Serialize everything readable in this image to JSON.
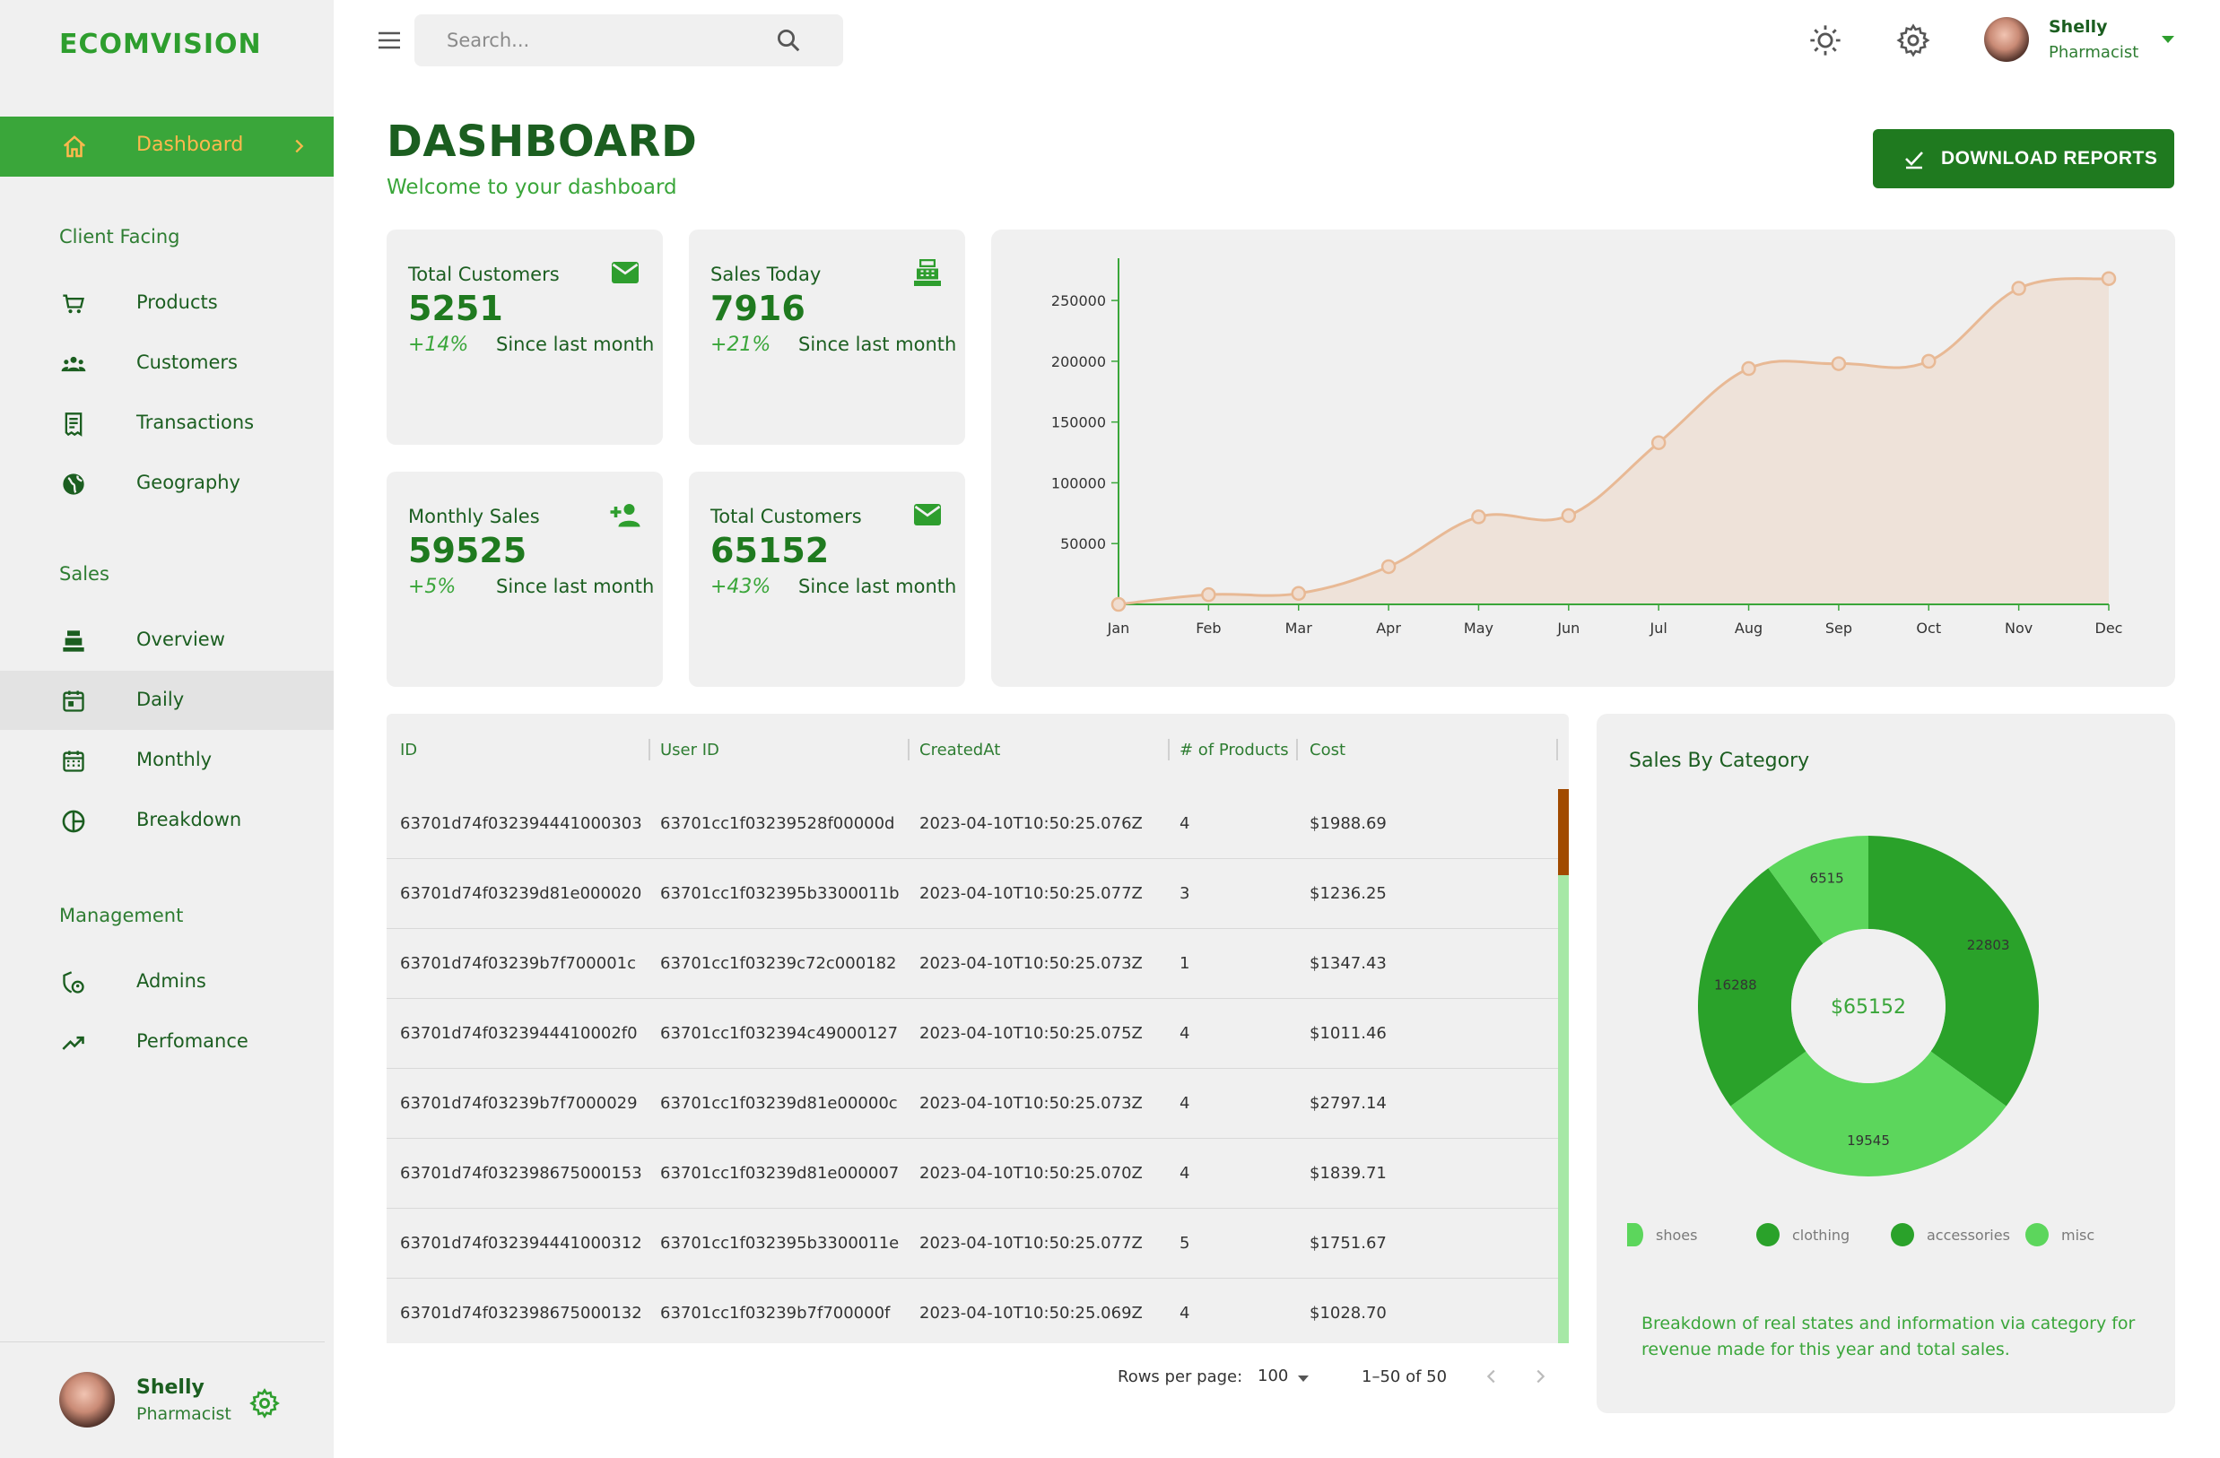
{
  "brand": "ECOMVISION",
  "sidebar": {
    "active": {
      "label": "Dashboard",
      "icon": "home-icon"
    },
    "sections": {
      "client_facing": "Client Facing",
      "sales": "Sales",
      "management": "Management"
    },
    "items": [
      {
        "label": "Products",
        "icon": "cart-icon"
      },
      {
        "label": "Customers",
        "icon": "people-icon"
      },
      {
        "label": "Transactions",
        "icon": "receipt-icon"
      },
      {
        "label": "Geography",
        "icon": "globe-icon"
      },
      {
        "label": "Overview",
        "icon": "cash-register-icon"
      },
      {
        "label": "Daily",
        "icon": "calendar-today-icon"
      },
      {
        "label": "Monthly",
        "icon": "calendar-month-icon"
      },
      {
        "label": "Breakdown",
        "icon": "pie-icon"
      },
      {
        "label": "Admins",
        "icon": "admin-icon"
      },
      {
        "label": "Perfomance",
        "icon": "trending-up-icon"
      }
    ],
    "user": {
      "name": "Shelly",
      "role": "Pharmacist"
    }
  },
  "topbar": {
    "search_placeholder": "Search...",
    "user": {
      "name": "Shelly",
      "role": "Pharmacist"
    }
  },
  "header": {
    "title": "DASHBOARD",
    "subtitle": "Welcome to your dashboard",
    "download_label": "DOWNLOAD REPORTS"
  },
  "stats": [
    {
      "title": "Total Customers",
      "value": "5251",
      "increase": "+14%",
      "note": "Since last month",
      "icon": "email-icon"
    },
    {
      "title": "Sales Today",
      "value": "7916",
      "increase": "+21%",
      "note": "Since last month",
      "icon": "point-of-sale-icon"
    },
    {
      "title": "Monthly Sales",
      "value": "59525",
      "increase": "+5%",
      "note": "Since last month",
      "icon": "person-add-icon"
    },
    {
      "title": "Total Customers",
      "value": "65152",
      "increase": "+43%",
      "note": "Since last month",
      "icon": "email-icon"
    }
  ],
  "chart_data": [
    {
      "type": "area",
      "x": [
        "Jan",
        "Feb",
        "Mar",
        "Apr",
        "May",
        "Jun",
        "Jul",
        "Aug",
        "Sep",
        "Oct",
        "Nov",
        "Dec"
      ],
      "series": [
        {
          "values": [
            0,
            8000,
            9000,
            31000,
            72000,
            73000,
            133000,
            194000,
            198000,
            200000,
            260000,
            268000
          ]
        }
      ],
      "y_ticks": [
        "50000",
        "100000",
        "150000",
        "200000",
        "250000"
      ],
      "ylim": [
        0,
        270000
      ],
      "grid": false,
      "color": "#e8b995"
    },
    {
      "type": "pie",
      "title": "Sales By Category",
      "center_label": "$65152",
      "categories": [
        "shoes",
        "clothing",
        "accessories",
        "misc"
      ],
      "values": [
        22803,
        19545,
        16288,
        6515
      ],
      "colors": [
        "#2aa22a",
        "#5cd65c",
        "#2aa22a",
        "#5cd65c"
      ],
      "legend_position": "bottom"
    }
  ],
  "table": {
    "columns": [
      "ID",
      "User ID",
      "CreatedAt",
      "# of Products",
      "Cost"
    ],
    "rows": [
      [
        "63701d74f032394441000303",
        "63701cc1f03239528f00000d",
        "2023-04-10T10:50:25.076Z",
        "4",
        "$1988.69"
      ],
      [
        "63701d74f03239d81e000020",
        "63701cc1f032395b3300011b",
        "2023-04-10T10:50:25.077Z",
        "3",
        "$1236.25"
      ],
      [
        "63701d74f03239b7f700001c",
        "63701cc1f03239c72c000182",
        "2023-04-10T10:50:25.073Z",
        "1",
        "$1347.43"
      ],
      [
        "63701d74f0323944410002f0",
        "63701cc1f032394c49000127",
        "2023-04-10T10:50:25.075Z",
        "4",
        "$1011.46"
      ],
      [
        "63701d74f03239b7f7000029",
        "63701cc1f03239d81e00000c",
        "2023-04-10T10:50:25.073Z",
        "4",
        "$2797.14"
      ],
      [
        "63701d74f032398675000153",
        "63701cc1f03239d81e000007",
        "2023-04-10T10:50:25.070Z",
        "4",
        "$1839.71"
      ],
      [
        "63701d74f032394441000312",
        "63701cc1f032395b3300011e",
        "2023-04-10T10:50:25.077Z",
        "5",
        "$1751.67"
      ],
      [
        "63701d74f032398675000132",
        "63701cc1f03239b7f700000f",
        "2023-04-10T10:50:25.069Z",
        "4",
        "$1028.70"
      ]
    ],
    "pagination": {
      "rows_per_page_label": "Rows per page:",
      "rows_per_page": "100",
      "range": "1–50 of 50"
    }
  },
  "pie_description": "Breakdown of real states and information via category for revenue made for this year and total sales.",
  "colors": {
    "brand": "#2e9e2e",
    "dark": "#1b5e20",
    "accent": "#ffb84d",
    "area": "#e8b995"
  }
}
